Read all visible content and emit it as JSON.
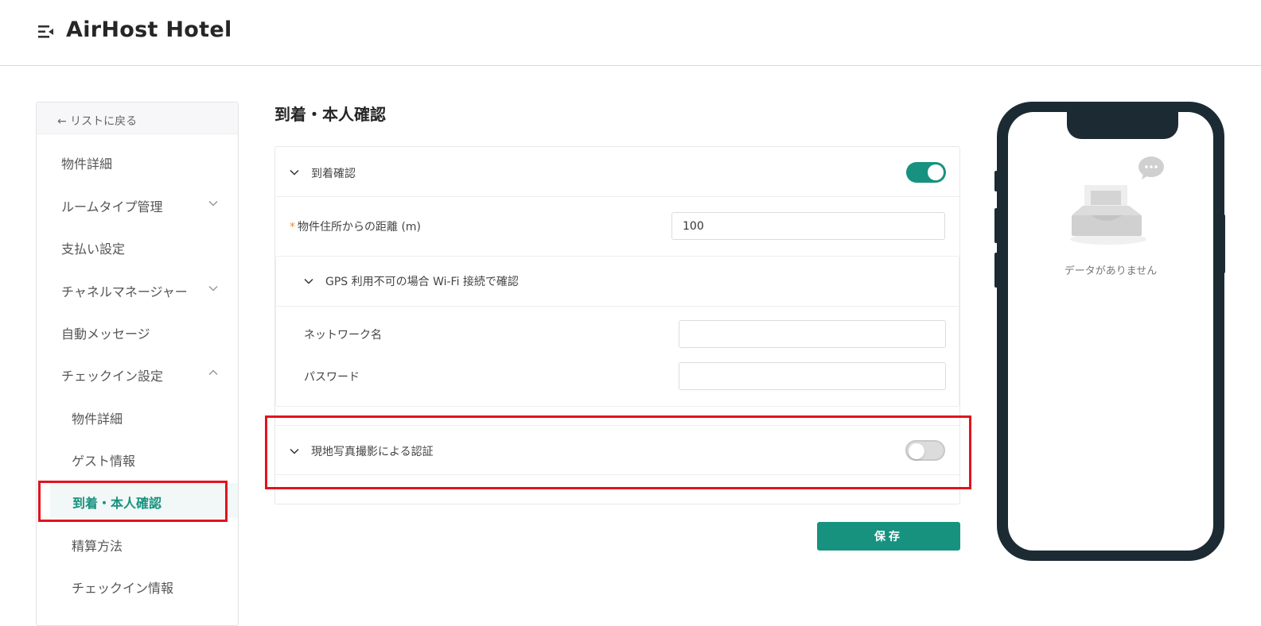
{
  "header": {
    "app_title": "AirHost Hotel"
  },
  "sidebar": {
    "back_label": "← リストに戻る",
    "items": [
      {
        "label": "物件詳細"
      },
      {
        "label": "ルームタイプ管理"
      },
      {
        "label": "支払い設定"
      },
      {
        "label": "チャネルマネージャー"
      },
      {
        "label": "自動メッセージ"
      },
      {
        "label": "チェックイン設定"
      },
      {
        "label": "物件詳細"
      },
      {
        "label": "ゲスト情報"
      },
      {
        "label": "到着・本人確認"
      },
      {
        "label": "精算方法"
      },
      {
        "label": "チェックイン情報"
      }
    ]
  },
  "main": {
    "page_title": "到着・本人確認",
    "arrival": {
      "title": "到着確認",
      "enabled": true
    },
    "distance": {
      "required_mark": "*",
      "label": "物件住所からの距離 (m)",
      "value": "100"
    },
    "wifi": {
      "title": "GPS 利用不可の場合 Wi-Fi 接続で確認",
      "network_label": "ネットワーク名",
      "network_value": "",
      "password_label": "パスワード",
      "password_value": ""
    },
    "photo": {
      "title": "現地写真撮影による認証",
      "enabled": false
    },
    "save_label": "保存"
  },
  "preview": {
    "empty_text": "データがありません"
  },
  "colors": {
    "accent": "#17927f",
    "highlight": "#e0141e"
  }
}
